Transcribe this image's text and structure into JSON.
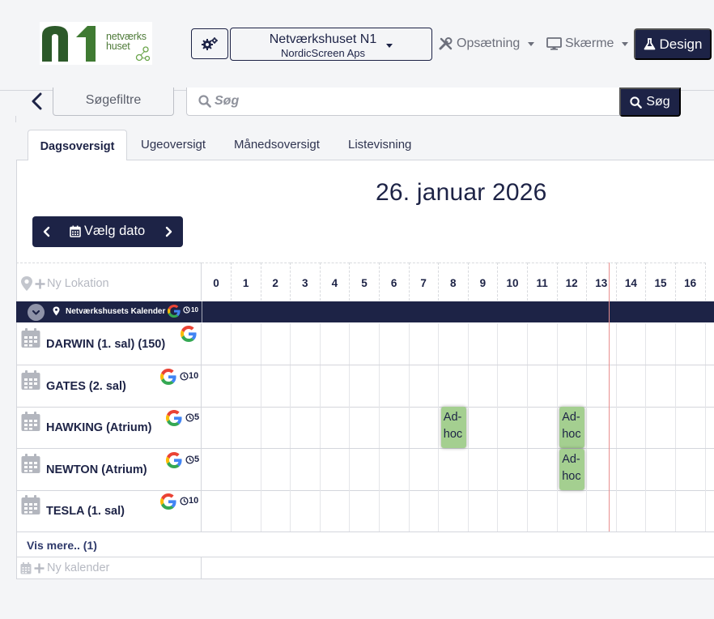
{
  "brand": {
    "logo_mark": "n1",
    "logo_line1": "netværks",
    "logo_line2": "huset",
    "logo_color": "#2d5a2a"
  },
  "header": {
    "settings_icon": "cogs-icon",
    "location_name": "Netværkshuset N1",
    "location_company": "NordicScreen Aps",
    "setup_label": "Opsætning",
    "screens_label": "Skærme",
    "design_label": "Design"
  },
  "search": {
    "filters_label": "Søgefiltre",
    "placeholder": "Søg",
    "button_label": "Søg"
  },
  "tabs": [
    {
      "label": "Dagsoversigt",
      "active": true
    },
    {
      "label": "Ugeoversigt",
      "active": false
    },
    {
      "label": "Månedsoversigt",
      "active": false
    },
    {
      "label": "Listevisning",
      "active": false
    }
  ],
  "calendar": {
    "date_title": "26. januar 2026",
    "pick_date_label": "Vælg dato",
    "new_location_label": "Ny Lokation",
    "hours": [
      "0",
      "1",
      "2",
      "3",
      "4",
      "5",
      "6",
      "7",
      "8",
      "9",
      "10",
      "11",
      "12",
      "13",
      "14",
      "15",
      "16"
    ],
    "group": {
      "name": "Netværkshusets Kalender",
      "count": "10"
    },
    "rooms": [
      {
        "name": "DARWIN (1. sal) (150)",
        "count": ""
      },
      {
        "name": "GATES (2. sal)",
        "count": "10"
      },
      {
        "name": "HAWKING (Atrium)",
        "count": "5"
      },
      {
        "name": "NEWTON (Atrium)",
        "count": "5"
      },
      {
        "name": "TESLA (1. sal)",
        "count": "10"
      }
    ],
    "events": [
      {
        "room": "HAWKING (Atrium)",
        "hour": "8",
        "label": "Ad-hoc"
      },
      {
        "room": "HAWKING (Atrium)",
        "hour": "12",
        "label": "Ad-hoc"
      },
      {
        "room": "NEWTON (Atrium)",
        "hour": "12",
        "label": "Ad-hoc"
      }
    ],
    "show_more_label": "Vis mere.. (1)",
    "new_calendar_label": "Ny kalender"
  },
  "colors": {
    "primary": "#1d2346",
    "event_green": "#a4cf90",
    "now_line": "#e88f8f"
  }
}
